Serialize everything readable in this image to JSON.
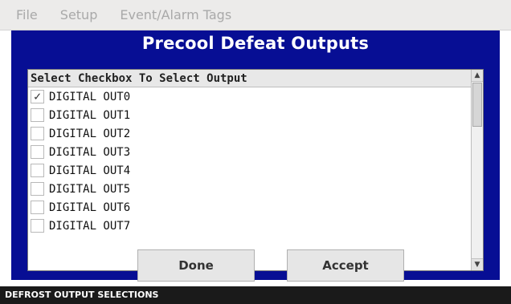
{
  "menu": {
    "items": [
      {
        "label": "File"
      },
      {
        "label": "Setup"
      },
      {
        "label": "Event/Alarm Tags"
      }
    ]
  },
  "dialog": {
    "title": "Precool Defeat Outputs",
    "list_header": "Select Checkbox To Select Output",
    "outputs": [
      {
        "label": "DIGITAL OUT0",
        "checked": true
      },
      {
        "label": "DIGITAL OUT1",
        "checked": false
      },
      {
        "label": "DIGITAL OUT2",
        "checked": false
      },
      {
        "label": "DIGITAL OUT3",
        "checked": false
      },
      {
        "label": "DIGITAL OUT4",
        "checked": false
      },
      {
        "label": "DIGITAL OUT5",
        "checked": false
      },
      {
        "label": "DIGITAL OUT6",
        "checked": false
      },
      {
        "label": "DIGITAL OUT7",
        "checked": false
      }
    ],
    "check_glyph": "✓",
    "scroll_up_glyph": "▲",
    "scroll_down_glyph": "▼",
    "buttons": {
      "done_label": "Done",
      "accept_label": "Accept"
    }
  },
  "status_bar": {
    "text": "DEFROST OUTPUT SELECTIONS"
  },
  "colors": {
    "window_background": "#070e94",
    "status_bar_background": "#1a1a1a",
    "menu_text_disabled": "#a9a9a9"
  }
}
